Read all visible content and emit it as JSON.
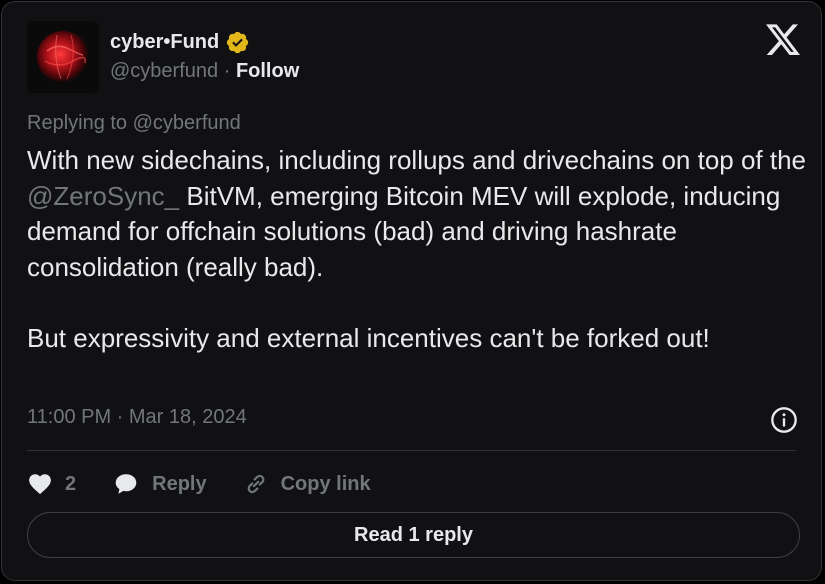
{
  "author": {
    "name": "cyber•Fund",
    "handle": "@cyberfund",
    "separator": "·",
    "follow_label": "Follow",
    "verified": true
  },
  "replying_to": "Replying to @cyberfund",
  "tweet": {
    "line1_pre": "With new sidechains, including rollups and drivechains on top of the ",
    "mention": "@ZeroSync_",
    "line1_post": " BitVM, emerging Bitcoin MEV will explode, inducing demand for offchain solutions (bad) and driving hashrate consolidation (really bad).",
    "paragraph2": "But expressivity and external incentives can't be forked out!"
  },
  "timestamp": "11:00 PM · Mar 18, 2024",
  "actions": {
    "like_count": "2",
    "reply_label": "Reply",
    "copy_label": "Copy link"
  },
  "read_replies_label": "Read 1 reply",
  "icons": {
    "logo": "x-logo-icon",
    "verified": "verified-badge-icon",
    "info": "info-icon",
    "like": "heart-icon",
    "reply": "speech-bubble-icon",
    "copy": "link-icon"
  },
  "colors": {
    "background": "#111113",
    "text": "#e7e9ea",
    "muted": "#71767b",
    "verified_gold": "#e2b719",
    "border": "#2f3336"
  }
}
